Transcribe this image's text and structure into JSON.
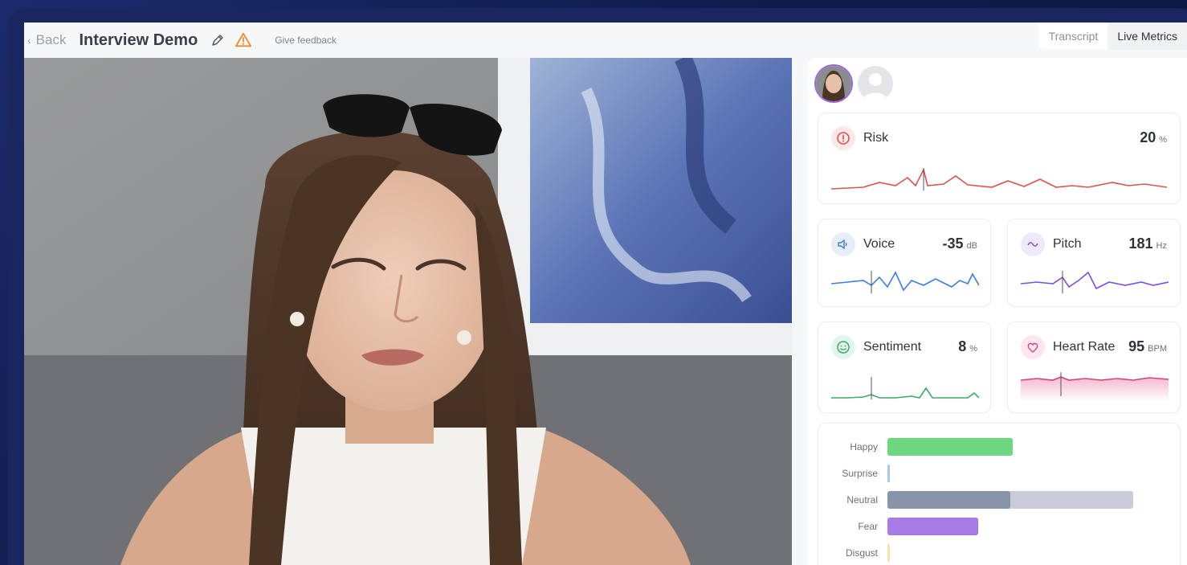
{
  "header": {
    "back_label": "Back",
    "title": "Interview Demo",
    "feedback_label": "Give feedback",
    "tabs": [
      {
        "label": "Transcript",
        "active": false
      },
      {
        "label": "Live Metrics",
        "active": true
      }
    ]
  },
  "metrics": {
    "risk": {
      "label": "Risk",
      "value": "20",
      "unit": "%",
      "color": "#d9534f"
    },
    "voice": {
      "label": "Voice",
      "value": "-35",
      "unit": "dB",
      "color": "#3b7de0"
    },
    "pitch": {
      "label": "Pitch",
      "value": "181",
      "unit": "Hz",
      "color": "#7c4fe0"
    },
    "sentiment": {
      "label": "Sentiment",
      "value": "8",
      "unit": "%",
      "color": "#3bab6a"
    },
    "heart_rate": {
      "label": "Heart Rate",
      "value": "95",
      "unit": "BPM",
      "color": "#d63f7a"
    }
  },
  "emotions": [
    {
      "label": "Happy",
      "value": 0.51,
      "color": "#6cd77f",
      "track": "#6cd77f"
    },
    {
      "label": "Surprise",
      "value": 0.01,
      "color": "#a7c7ef",
      "track": "#ffffff"
    },
    {
      "label": "Neutral",
      "value": 0.5,
      "color": "#8894aa",
      "track": "#c7ccd8"
    },
    {
      "label": "Fear",
      "value": 0.37,
      "color": "#a77ae6",
      "track": "#d6c0f4"
    },
    {
      "label": "Disgust",
      "value": 0.0,
      "color": "#f2e3a8",
      "track": "#ffffff"
    }
  ],
  "icons": {
    "back": "chevron-left-icon",
    "edit": "pencil-icon",
    "warning": "warning-icon"
  }
}
